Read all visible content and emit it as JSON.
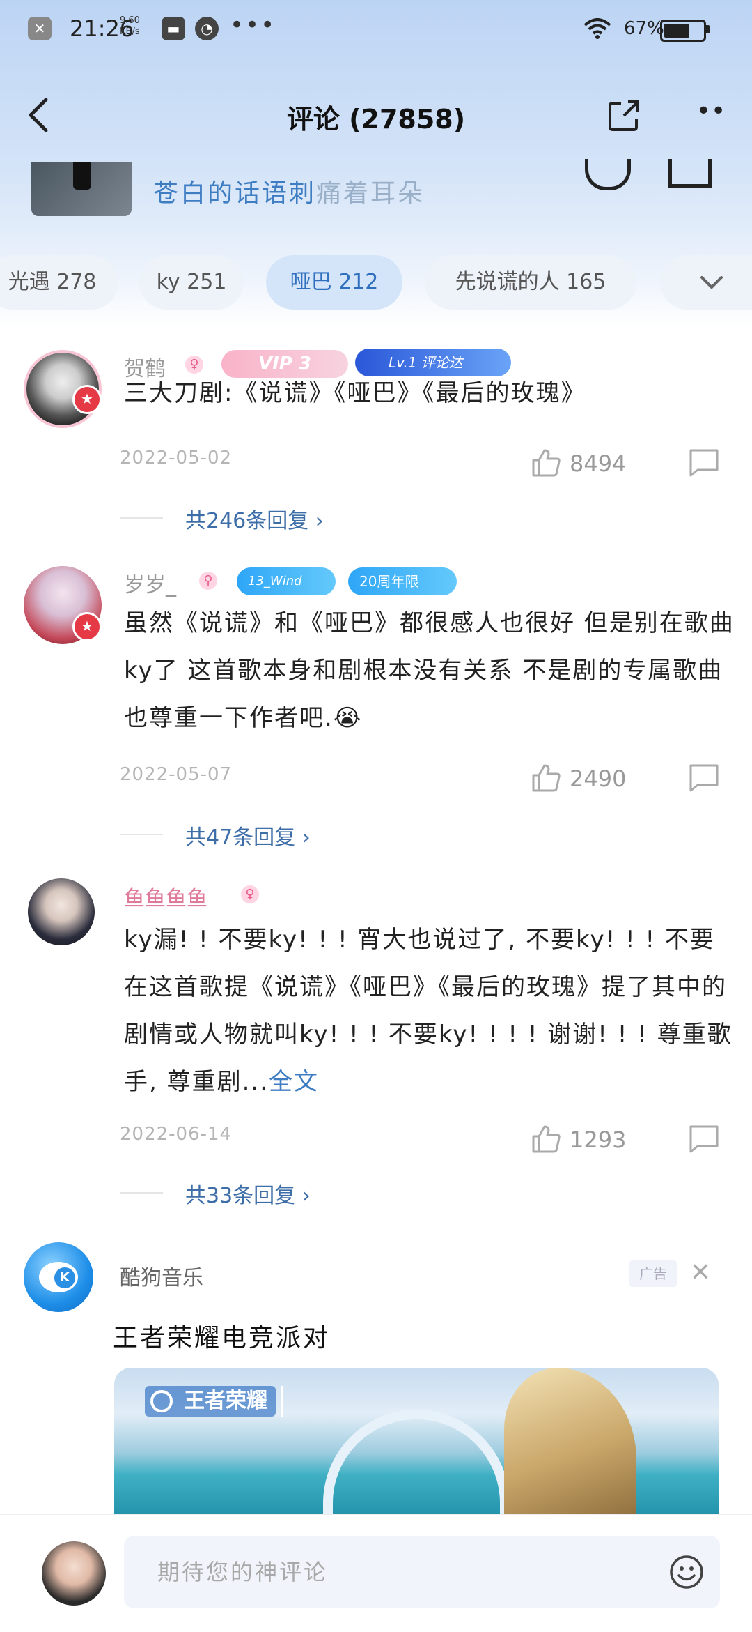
{
  "status": {
    "time": "21:26",
    "speed_value": "9.60",
    "speed_unit": "KB/s",
    "battery": "67%",
    "battery_level": 0.67
  },
  "nav": {
    "title": "评论 (27858)"
  },
  "song": {
    "title_main": "苍白的话语刺",
    "title_fade": "痛着耳朵"
  },
  "tabs": [
    {
      "label": "光遇 278",
      "active": false
    },
    {
      "label": "ky 251",
      "active": false
    },
    {
      "label": "哑巴 212",
      "active": true
    },
    {
      "label": "先说谎的人 165",
      "active": false
    }
  ],
  "comments": [
    {
      "username": "贺鹤",
      "badges": [
        "VIP 3",
        "Lv.1 评论达"
      ],
      "text": "三大刀剧:《说谎》《哑巴》《最后的玫瑰》",
      "date": "2022-05-02",
      "likes": "8494",
      "replies": "共246条回复 ›"
    },
    {
      "username": "岁岁_",
      "badges": [
        "13_Wind",
        "20周年限"
      ],
      "text": "虽然《说谎》和《哑巴》都很感人也很好 但是别在歌曲ky了 这首歌本身和剧根本没有关系 不是剧的专属歌曲 也尊重一下作者吧.😭",
      "date": "2022-05-07",
      "likes": "2490",
      "replies": "共47条回复 ›"
    },
    {
      "username": "鱼鱼鱼鱼",
      "badges": [],
      "text": "ky漏! ! 不要ky! ! ! 宵大也说过了, 不要ky! ! ! 不要在这首歌提《说谎》《哑巴》《最后的玫瑰》提了其中的剧情或人物就叫ky! ! ! 不要ky! ! ! ! 谢谢! ! ! 尊重歌手, 尊重剧...",
      "more": "全文",
      "date": "2022-06-14",
      "likes": "1293",
      "replies": "共33条回复 ›"
    }
  ],
  "ad": {
    "name": "酷狗音乐",
    "tag": "广告",
    "headline": "王者荣耀电竞派对",
    "logo_text": "王者荣耀"
  },
  "input": {
    "placeholder": "期待您的神评论"
  },
  "colors": {
    "accent": "#3f7dc3",
    "tab_active_bg": "#d5e5f9",
    "header_gradient_top": "#bcd4f4"
  }
}
